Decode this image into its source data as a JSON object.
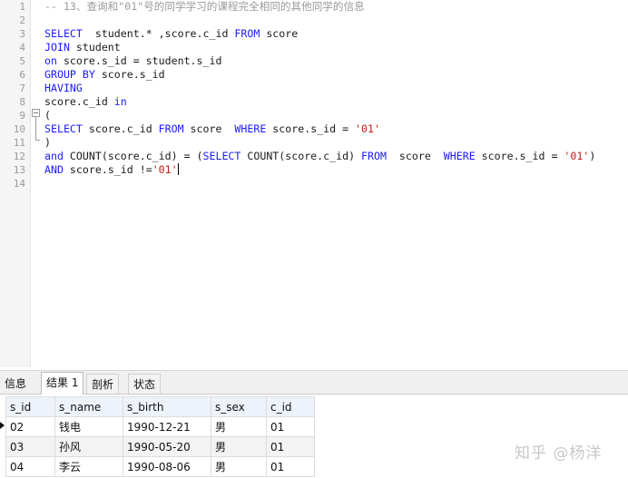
{
  "editor": {
    "line_numbers": [
      "1",
      "2",
      "3",
      "4",
      "5",
      "6",
      "7",
      "8",
      "9",
      "10",
      "11",
      "12",
      "13",
      "14"
    ],
    "lines": [
      [
        {
          "t": "-- 13、查询和\"01\"号的同学学习的课程完全相同的其他同学的信息",
          "c": "cm"
        }
      ],
      [],
      [
        {
          "t": "SELECT",
          "c": "kw"
        },
        {
          "t": "  student.* ,score.c_id ",
          "c": ""
        },
        {
          "t": "FROM",
          "c": "kw"
        },
        {
          "t": " score",
          "c": ""
        }
      ],
      [
        {
          "t": "JOIN",
          "c": "kw"
        },
        {
          "t": " student",
          "c": ""
        }
      ],
      [
        {
          "t": "on",
          "c": "kw"
        },
        {
          "t": " score.s_id = student.s_id",
          "c": ""
        }
      ],
      [
        {
          "t": "GROUP BY",
          "c": "kw"
        },
        {
          "t": " score.s_id",
          "c": ""
        }
      ],
      [
        {
          "t": "HAVING",
          "c": "kw"
        }
      ],
      [
        {
          "t": "score.c_id ",
          "c": ""
        },
        {
          "t": "in",
          "c": "kw"
        }
      ],
      [
        {
          "t": "(",
          "c": ""
        }
      ],
      [
        {
          "t": "SELECT",
          "c": "kw"
        },
        {
          "t": " score.c_id ",
          "c": ""
        },
        {
          "t": "FROM",
          "c": "kw"
        },
        {
          "t": " score  ",
          "c": ""
        },
        {
          "t": "WHERE",
          "c": "kw"
        },
        {
          "t": " score.s_id = ",
          "c": ""
        },
        {
          "t": "'01'",
          "c": "str"
        }
      ],
      [
        {
          "t": ")",
          "c": ""
        }
      ],
      [
        {
          "t": "and",
          "c": "kw"
        },
        {
          "t": " COUNT(score.c_id) = (",
          "c": ""
        },
        {
          "t": "SELECT",
          "c": "kw"
        },
        {
          "t": " COUNT(score.c_id) ",
          "c": ""
        },
        {
          "t": "FROM",
          "c": "kw"
        },
        {
          "t": "  score  ",
          "c": ""
        },
        {
          "t": "WHERE",
          "c": "kw"
        },
        {
          "t": " score.s_id = ",
          "c": ""
        },
        {
          "t": "'01'",
          "c": "str"
        },
        {
          "t": ")",
          "c": ""
        }
      ],
      [
        {
          "t": "AND",
          "c": "kw"
        },
        {
          "t": " score.s_id !=",
          "c": ""
        },
        {
          "t": "'01'",
          "c": "str"
        },
        {
          "t": "",
          "c": "caret"
        }
      ],
      []
    ]
  },
  "tabs": [
    {
      "label": "信息",
      "active": false
    },
    {
      "label": "结果 1",
      "active": true
    },
    {
      "label": "剖析",
      "active": false
    },
    {
      "label": "状态",
      "active": false
    }
  ],
  "results": {
    "columns": [
      "s_id",
      "s_name",
      "s_birth",
      "s_sex",
      "c_id"
    ],
    "rows": [
      [
        "02",
        "钱电",
        "1990-12-21",
        "男",
        "01"
      ],
      [
        "03",
        "孙风",
        "1990-05-20",
        "男",
        "01"
      ],
      [
        "04",
        "李云",
        "1990-08-06",
        "男",
        "01"
      ]
    ]
  },
  "watermark": "知乎 @杨洋"
}
